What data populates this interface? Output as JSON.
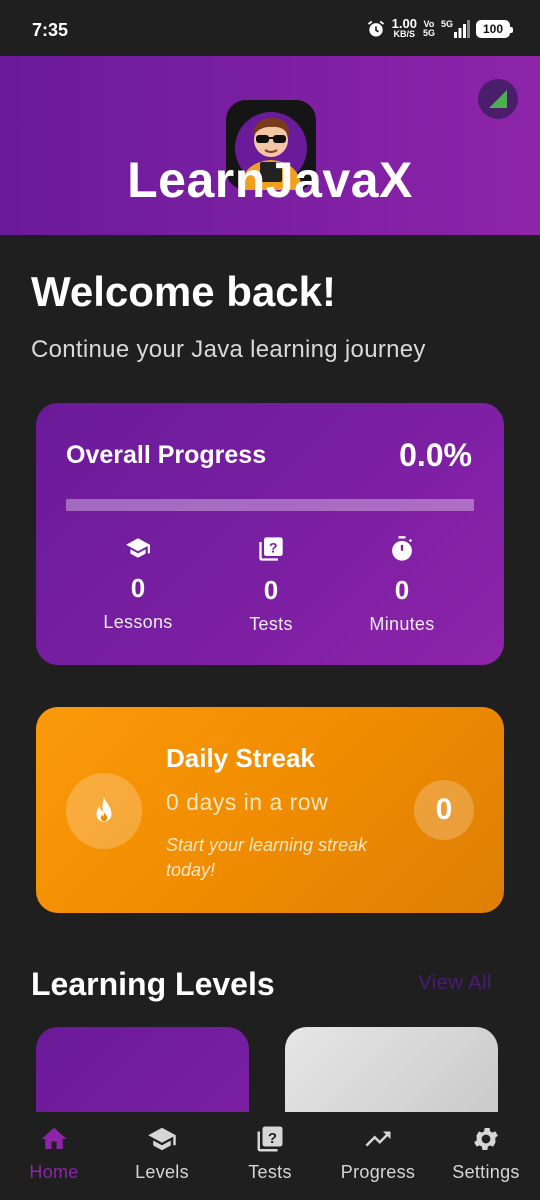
{
  "status_bar": {
    "time": "7:35",
    "network_speed": "1.00",
    "network_unit": "KB/S",
    "volte": "Vo",
    "volte_sub": "5G",
    "signal": "5G",
    "battery": "100"
  },
  "header": {
    "title": "LearnJavaX"
  },
  "welcome": {
    "title": "Welcome back!",
    "subtitle": "Continue your Java learning journey"
  },
  "progress": {
    "title": "Overall Progress",
    "percent_text": "0.0%",
    "percent_value": 0.0,
    "stats": [
      {
        "icon": "graduation-cap-icon",
        "value": "0",
        "label": "Lessons"
      },
      {
        "icon": "quiz-icon",
        "value": "0",
        "label": "Tests"
      },
      {
        "icon": "timer-icon",
        "value": "0",
        "label": "Minutes"
      }
    ]
  },
  "streak": {
    "title": "Daily Streak",
    "days_text": "0 days in a row",
    "hint": "Start your learning streak today!",
    "count": "0",
    "icon": "flame-icon"
  },
  "levels": {
    "title": "Learning Levels",
    "view_all": "View All"
  },
  "nav": {
    "items": [
      {
        "label": "Home",
        "icon": "home-icon",
        "active": true
      },
      {
        "label": "Levels",
        "icon": "graduation-cap-icon",
        "active": false
      },
      {
        "label": "Tests",
        "icon": "quiz-icon",
        "active": false
      },
      {
        "label": "Progress",
        "icon": "trending-up-icon",
        "active": false
      },
      {
        "label": "Settings",
        "icon": "gear-icon",
        "active": false
      }
    ]
  },
  "colors": {
    "primary": "#7b1fa2",
    "streak": "#f08c00",
    "background": "#1f1f1f"
  }
}
